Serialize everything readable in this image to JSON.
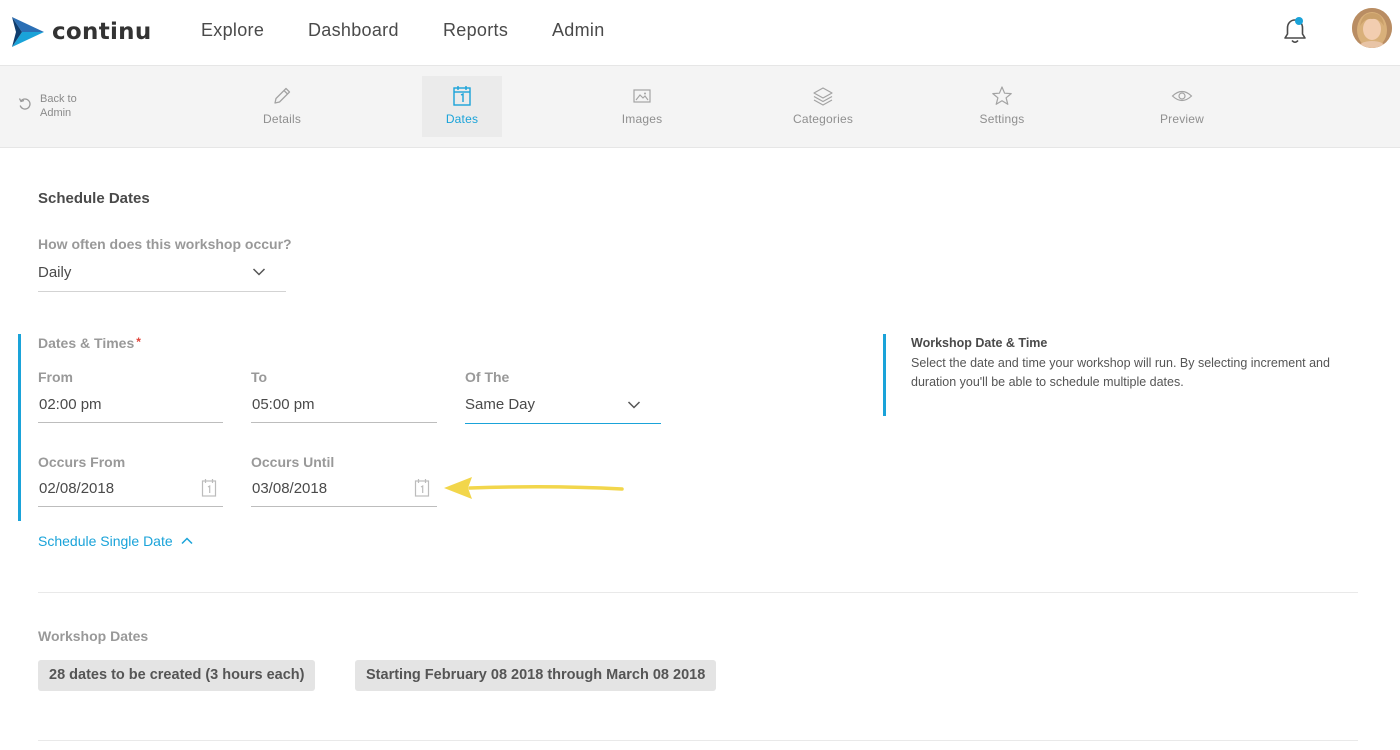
{
  "app": {
    "logo_text": "continu",
    "brand_color": "#1aa3d9",
    "logo_colors": [
      "#2b6fb5",
      "#1aa3d9",
      "#0f3d6e"
    ]
  },
  "topnav": {
    "items": [
      {
        "label": "Explore"
      },
      {
        "label": "Dashboard"
      },
      {
        "label": "Reports"
      },
      {
        "label": "Admin"
      }
    ],
    "notification_icon": "bell-icon",
    "has_notification": true
  },
  "subnav": {
    "back_label": "Back to Admin",
    "tabs": [
      {
        "label": "Details",
        "icon": "pencil-icon",
        "active": false
      },
      {
        "label": "Dates",
        "icon": "calendar-icon",
        "active": true
      },
      {
        "label": "Images",
        "icon": "image-icon",
        "active": false
      },
      {
        "label": "Categories",
        "icon": "layers-icon",
        "active": false
      },
      {
        "label": "Settings",
        "icon": "star-icon",
        "active": false
      },
      {
        "label": "Preview",
        "icon": "eye-icon",
        "active": false
      }
    ]
  },
  "schedule": {
    "title": "Schedule Dates",
    "frequency_question": "How often does this workshop occur?",
    "frequency_value": "Daily",
    "dates_times_label": "Dates & Times",
    "required_mark": "*",
    "from_label": "From",
    "from_value": "02:00 pm",
    "to_label": "To",
    "to_value": "05:00 pm",
    "of_the_label": "Of The",
    "of_the_value": "Same Day",
    "occurs_from_label": "Occurs From",
    "occurs_from_value": "02/08/2018",
    "occurs_until_label": "Occurs Until",
    "occurs_until_value": "03/08/2018",
    "single_date_link": "Schedule Single Date"
  },
  "help": {
    "title": "Workshop Date & Time",
    "text": "Select the date and time your workshop will run. By selecting increment and duration you'll be able to schedule multiple dates."
  },
  "workshop_dates": {
    "label": "Workshop Dates",
    "count_pill": "28 dates to be created (3 hours each)",
    "range_pill": "Starting February 08 2018 through March 08 2018"
  },
  "annotation": {
    "arrow_color": "#f2d64b"
  }
}
